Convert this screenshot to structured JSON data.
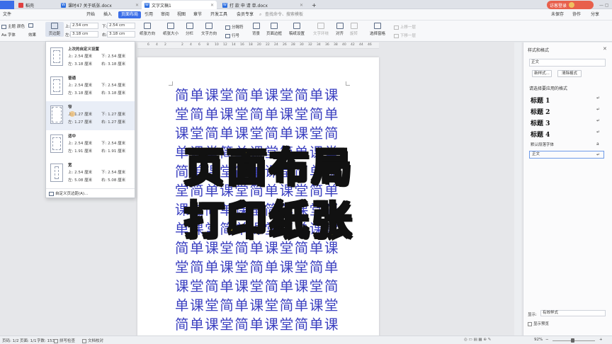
{
  "tabs": [
    {
      "label": "稻壳"
    },
    {
      "label": "课时47  关于纸张.docx"
    },
    {
      "label": "文字文稿1"
    },
    {
      "label": "打 款 申 请 单.docx"
    }
  ],
  "top_right": {
    "login": "访客登录"
  },
  "menu": [
    "文件",
    "开始",
    "插入",
    "页面布局",
    "引用",
    "审阅",
    "视图",
    "章节",
    "开发工具",
    "会员专享"
  ],
  "menu_active": "页面布局",
  "search_placeholder": "查找命令、搜索模板",
  "menu_right": [
    "未保存",
    "协作",
    "分享"
  ],
  "ribbon": {
    "theme": "主题",
    "colors": "颜色",
    "fonts": "Aa 字体",
    "effects": "效果",
    "margins": "页边距",
    "top_label": "上:",
    "top_val": "2.54 cm",
    "bottom_label": "下:",
    "bottom_val": "2.54 cm",
    "left_label": "左:",
    "left_val": "3.18 cm",
    "right_label": "右:",
    "right_val": "3.18 cm",
    "orientation": "纸张方向",
    "size": "纸张大小",
    "columns": "分栏",
    "text_dir": "文字方向",
    "breaks": "分隔符",
    "line_num": "行号",
    "background": "背景",
    "border": "页面边框",
    "grid": "稿纸设置",
    "wrap": "文字环绕",
    "align": "对齐",
    "rotate": "旋转",
    "select_pane": "选择窗格",
    "up": "上移一层",
    "down": "下移一层"
  },
  "ruler_ticks": [
    "6",
    "4",
    "2",
    "2",
    "4",
    "6",
    "8",
    "10",
    "12",
    "14",
    "16",
    "18",
    "20",
    "22",
    "24",
    "26",
    "28",
    "30",
    "32",
    "34",
    "36",
    "38",
    "40",
    "42",
    "44",
    "46"
  ],
  "dropdown": {
    "options": [
      {
        "title": "上次的自定义设置",
        "top": "上: 2.54 厘米",
        "bottom": "下: 2.54 厘米",
        "left": "左: 3.18 厘米",
        "right": "右: 3.18 厘米"
      },
      {
        "title": "普通",
        "top": "上: 2.54 厘米",
        "bottom": "下: 2.54 厘米",
        "left": "左: 3.18 厘米",
        "right": "右: 3.18 厘米"
      },
      {
        "title": "窄",
        "top": "上: 1.27 厘米",
        "bottom": "下: 1.27 厘米",
        "left": "左: 1.27 厘米",
        "right": "右: 1.27 厘米"
      },
      {
        "title": "适中",
        "top": "上: 2.54 厘米",
        "bottom": "下: 2.54 厘米",
        "left": "左: 1.91 厘米",
        "right": "右: 1.91 厘米"
      },
      {
        "title": "宽",
        "top": "上: 2.54 厘米",
        "bottom": "下: 2.54 厘米",
        "left": "左: 5.08 厘米",
        "right": "右: 5.08 厘米"
      }
    ],
    "custom": "自定义页边距(A)..."
  },
  "doc_lines": [
    "简单课堂简单课堂简单课",
    "堂简单课堂简单课堂简单",
    "课堂简单课堂简单课堂简",
    "单课堂简单课堂简单课堂",
    "简单课堂简单课堂简单课",
    "堂简单课堂简单课堂简单",
    "课堂简单课堂简单课堂简",
    "单课堂简单课堂简单课堂",
    "简单课堂简单课堂简单课",
    "堂简单课堂简单课堂简单",
    "课堂简单课堂简单课堂简",
    "单课堂简单课堂简单课堂",
    "简单课堂简单课堂简单课"
  ],
  "overlay": {
    "line1": "页面布局",
    "line2": "打印纸张"
  },
  "panel": {
    "title": "样式和格式",
    "current": "正文",
    "new_btn": "新样式...",
    "clear_btn": "清除格式",
    "apply_label": "请选择要应用的格式",
    "styles": [
      "标题 1",
      "标题 2",
      "标题 3",
      "标题 4"
    ],
    "default_font": "默认段落字体",
    "body": "正文",
    "show_label": "显示:",
    "show_value": "有效样式",
    "preview": "显示预览"
  },
  "status": {
    "page": "页码: 1/2",
    "pages": "页面: 1/1",
    "words": "字数: 153",
    "spell": "拼写检查",
    "proof": "文档校对",
    "zoom": "92%"
  },
  "colors": {
    "accent": "#3b6ee8",
    "doc_text": "#3a3fc0",
    "overlay_fill": "#f6dd2a"
  }
}
